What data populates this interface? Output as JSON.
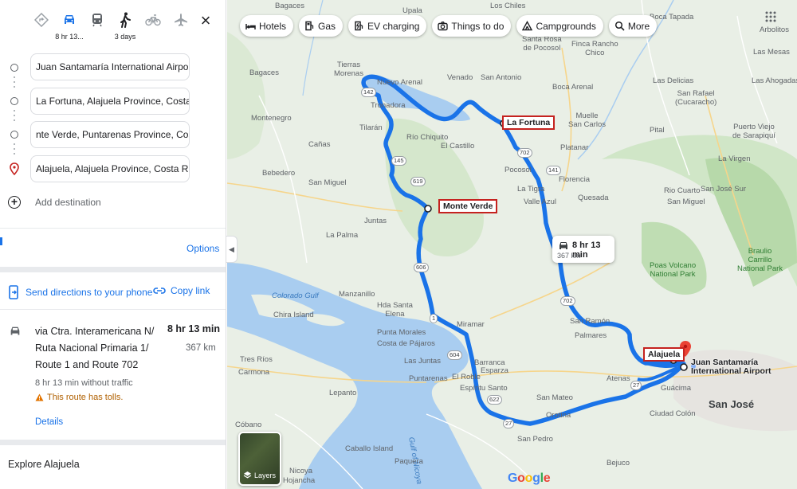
{
  "travel_modes": [
    {
      "name": "best",
      "icon": "diamond-directions-icon",
      "sub": ""
    },
    {
      "name": "driving",
      "icon": "car-icon",
      "sub": "8 hr 13..."
    },
    {
      "name": "transit",
      "icon": "train-icon",
      "sub": ""
    },
    {
      "name": "walking",
      "icon": "walking-icon",
      "sub": "3 days"
    },
    {
      "name": "cycling",
      "icon": "bicycle-icon",
      "sub": ""
    },
    {
      "name": "flights",
      "icon": "plane-icon",
      "sub": ""
    }
  ],
  "close_label": "×",
  "waypoints": [
    "Juan Santamaría International Airport, Al",
    "La Fortuna, Alajuela Province, Costa Rica",
    "nte Verde, Puntarenas Province, Costa Ric",
    "Alajuela, Alajuela Province, Costa Rica"
  ],
  "add_destination": "Add destination",
  "options_label": "Options",
  "send_directions": "Send directions to your phone",
  "copy_link": "Copy link",
  "route": {
    "via": "via Ctra. Interamericana N/ Ruta Nacional Primaria 1/ Route 1 and Route 702",
    "time": "8 hr 13 min",
    "distance": "367 km",
    "no_traffic": "8 hr 13 min without traffic",
    "tolls": "This route has tolls.",
    "details": "Details"
  },
  "explore": "Explore Alajuela",
  "map": {
    "chips": [
      "Hotels",
      "Gas",
      "EV charging",
      "Things to do",
      "Campgrounds",
      "More"
    ],
    "route_bubble": {
      "time": "8 hr 13 min",
      "distance": "367 km"
    },
    "destinations": {
      "fortuna": "La Fortuna",
      "monteverde": "Monte Verde",
      "alajuela": "Alajuela",
      "airport": "Juan Santamaría International Airport"
    },
    "layers_label": "Layers",
    "logo": [
      "G",
      "o",
      "o",
      "g",
      "l",
      "e"
    ],
    "places": {
      "bagaces_top": "Bagaces",
      "upala": "Upala",
      "boca_tapada": "Boca Tapada",
      "los_chiles": "Los Chiles",
      "arbolitos": "Arbolitos",
      "santa_rosa_pocosol": "Santa Rosa\nde Pocosol",
      "finca_rancho_chico": "Finca Rancho\nChico",
      "las_mesas": "Las Mesas",
      "tierras_morenas": "Tierras\nMorenas",
      "bagaces": "Bagaces",
      "nuevo_arenal": "Nuevo Arenal",
      "venado": "Venado",
      "san_antonio": "San Antonio",
      "boca_arenal": "Boca Arenal",
      "las_delicias": "Las Delicias",
      "las_ahogadas": "Las Ahogadas",
      "tronadora": "Tronadora",
      "montenegro": "Montenegro",
      "san_rafael_cucaracho": "San Rafael\n(Cucaracho)",
      "tilaran": "Tilarán",
      "muelle_san_carlos": "Muelle\nSan Carlos",
      "rio_chiquito": "Río Chiquito",
      "pital": "Pital",
      "puerto_viejo": "Puerto Viejo\nde Sarapiquí",
      "canas": "Cañas",
      "el_castillo": "El Castillo",
      "platanar": "Platanar",
      "bebedero": "Bebedero",
      "la_virgen": "La Virgen",
      "pocosol": "Pocosol",
      "san_miguel_west": "San Miguel",
      "florencia": "Florencia",
      "la_tigra": "La Tigra",
      "quesada": "Quesada",
      "rio_cuarto": "Rio Cuarto",
      "san_jose_sur": "San José Sur",
      "valle_azul": "Valle Azul",
      "san_miguel_east": "San Miguel",
      "juntas": "Juntas",
      "la_palma": "La Palma",
      "poas": "Poas Volcano\nNational Park",
      "braulio": "Braulio\nCarrillo\nNational Park",
      "manzanillo": "Manzanillo",
      "hda_santa_elena": "Hda Santa\nElena",
      "colorado_gulf": "Colorado Gulf",
      "chira_island": "Chira Island",
      "punta_morales": "Punta Morales",
      "costa_de_pajaros": "Costa de Pájaros",
      "miramar": "Miramar",
      "san_ramon": "San Ramón",
      "palmares": "Palmares",
      "las_juntas": "Las Juntas",
      "barranca": "Barranca",
      "el_roble": "El Roble",
      "esparza": "Esparza",
      "puntarenas": "Puntarenas",
      "espiritu_santo": "Espíritu Santo",
      "atenas": "Atenas",
      "tres_rios": "Tres Ríos",
      "carmona": "Carmona",
      "lepanto": "Lepanto",
      "san_mateo": "San Mateo",
      "orotina": "Orotina",
      "guacima": "Guácima",
      "ciudad_colon": "Ciudad Colón",
      "san_jose": "San José",
      "cobano": "Cóbano",
      "gulf_nicoya": "Gulf of Nicoya",
      "paquera": "Paquera",
      "san_pedro": "San Pedro",
      "caballo_island": "Caballo Island",
      "bejuco": "Bejuco",
      "nicoya": "Nicoya",
      "hojancha": "Hojancha"
    }
  }
}
